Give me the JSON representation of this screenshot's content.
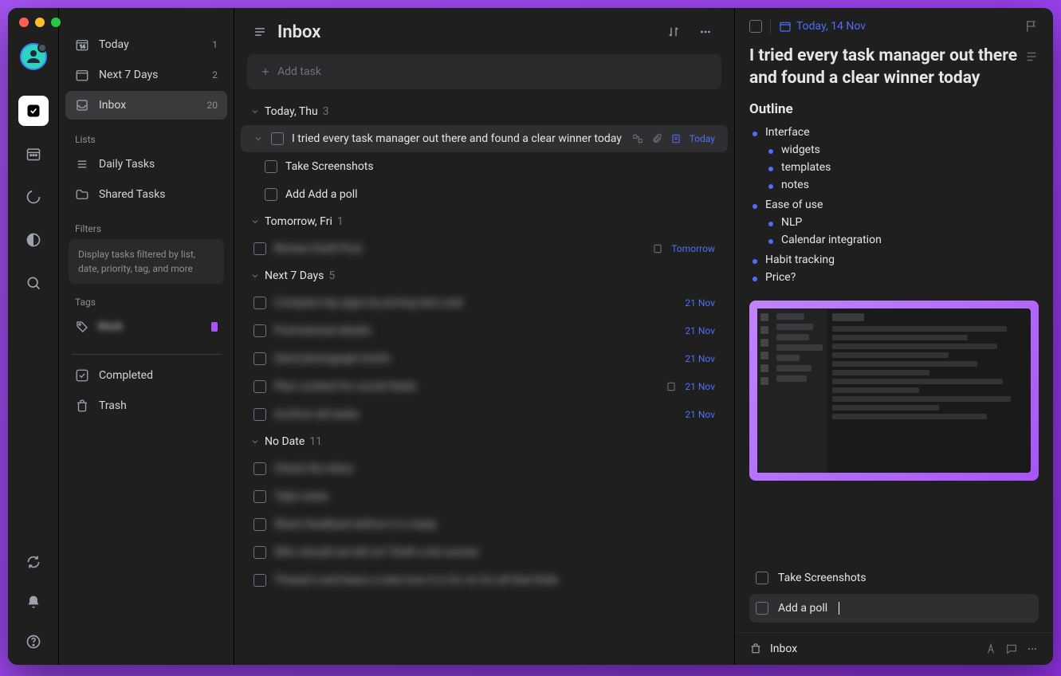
{
  "sidebar": {
    "today": {
      "label": "Today",
      "count": "1"
    },
    "next7": {
      "label": "Next 7 Days",
      "count": "2"
    },
    "inbox": {
      "label": "Inbox",
      "count": "20"
    },
    "lists_header": "Lists",
    "lists": [
      {
        "label": "Daily Tasks"
      },
      {
        "label": "Shared Tasks"
      }
    ],
    "filters_header": "Filters",
    "filters_tip": "Display tasks filtered by list, date, priority, tag, and more",
    "tags_header": "Tags",
    "tag_name": "Work",
    "completed": "Completed",
    "trash": "Trash"
  },
  "main": {
    "title": "Inbox",
    "add_task_placeholder": "Add task",
    "groups": {
      "today": {
        "label": "Today, Thu",
        "count": "3"
      },
      "tomorrow": {
        "label": "Tomorrow, Fri",
        "count": "1"
      },
      "next7": {
        "label": "Next 7 Days",
        "count": "5"
      },
      "nodate": {
        "label": "No Date",
        "count": "11"
      }
    },
    "tasks": {
      "selected": {
        "title": "I tried every task manager out there and found a clear winner today",
        "date": "Today"
      },
      "sub1": "Take Screenshots",
      "sub2": "Add Add a poll",
      "tomorrow1": {
        "title": "Review Draft Post",
        "date": "Tomorrow"
      },
      "n1": {
        "title": "Compare top apps by pricing tiers and",
        "date": "21 Nov"
      },
      "n2": {
        "title": "Promotional details",
        "date": "21 Nov"
      },
      "n3": {
        "title": "Send photograph briefs",
        "date": "21 Nov"
      },
      "n4": {
        "title": "Plan content for social feeds",
        "date": "21 Nov"
      },
      "n5": {
        "title": "Archive old tasks",
        "date": "21 Nov"
      },
      "d1": "Check the inbox",
      "d2": "Take notes",
      "d3": "Share feedback before it is ready",
      "d4": "Who should we tell on? Draft a list sooner",
      "d5": "Thread it and leave a note how it is for on for all that finds"
    }
  },
  "detail": {
    "date": "Today, 14 Nov",
    "title": "I tried every task manager out there and found a clear winner today",
    "outline_label": "Outline",
    "outline": [
      {
        "t": "Interface",
        "c": [
          "widgets",
          "templates",
          "notes"
        ]
      },
      {
        "t": "Ease of use",
        "c": [
          "NLP",
          "Calendar integration"
        ]
      },
      {
        "t": "Habit tracking"
      },
      {
        "t": "Price?"
      }
    ],
    "sub1": "Take Screenshots",
    "sub2": "Add a poll",
    "footer_location": "Inbox"
  }
}
